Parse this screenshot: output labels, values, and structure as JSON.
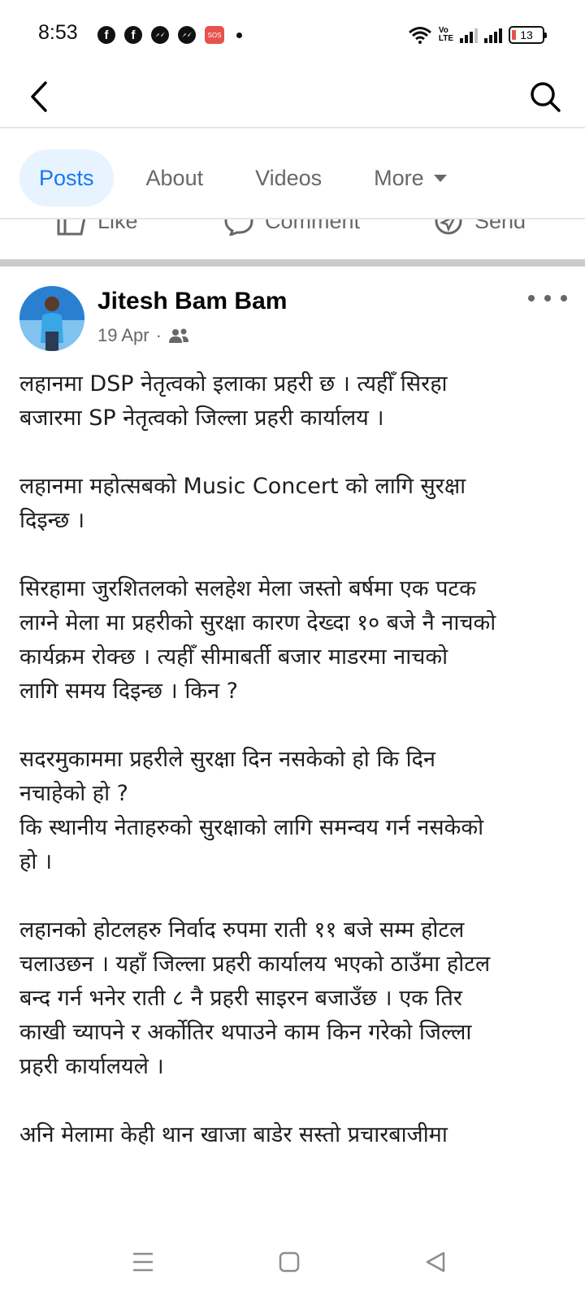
{
  "status_bar": {
    "time": "8:53",
    "battery": "13",
    "volte_label": "Vo\nLTE",
    "notification_icons": [
      "facebook-icon",
      "facebook-icon",
      "messenger-icon",
      "messenger-icon",
      "sos-icon"
    ]
  },
  "header": {
    "back_icon": "chevron-left-icon",
    "search_icon": "search-icon"
  },
  "tabs": [
    {
      "label": "Posts",
      "active": true
    },
    {
      "label": "About",
      "active": false
    },
    {
      "label": "Videos",
      "active": false
    },
    {
      "label": "More",
      "active": false
    }
  ],
  "action_bar": {
    "like": "Like",
    "comment": "Comment",
    "send": "Send"
  },
  "post": {
    "author": "Jitesh Bam Bam",
    "date": "19 Apr",
    "separator": "·",
    "audience_icon": "friends-icon",
    "paragraphs": [
      [
        "लहानमा DSP नेतृत्वको इलाका प्रहरी छ  । त्यहीँ सिरहा",
        "बजारमा SP नेतृत्वको जिल्ला प्रहरी कार्यालय ।"
      ],
      [
        "लहानमा महोत्सबको Music Concert को लागि सुरक्षा",
        "दिइन्छ ।"
      ],
      [
        "सिरहामा जुरशितलको सलहेश मेला जस्तो बर्षमा एक पटक",
        "लाग्ने मेला मा प्रहरीको सुरक्षा कारण देख्दा १० बजे नै नाचको",
        "कार्यक्रम रोक्छ । त्यहीँ सीमाबर्ती बजार माडरमा नाचको",
        "लागि समय दिइन्छ । किन ?"
      ],
      [
        "सदरमुकाममा प्रहरीले सुरक्षा दिन नसकेको हो कि दिन",
        "नचाहेको हो ?",
        "कि स्थानीय नेताहरुको सुरक्षाको लागि समन्वय गर्न नसकेको",
        "हो ।"
      ],
      [
        "लहानको होटलहरु निर्वाद रुपमा राती ११ बजे सम्म होटल",
        "चलाउछन । यहाँ जिल्ला प्रहरी कार्यालय भएको ठाउँमा होटल",
        "बन्द गर्न भनेर राती ८ नै प्रहरी साइरन बजाउँछ । एक तिर",
        "काखी च्यापने र अर्कोतिर थपाउने काम किन गरेको जिल्ला",
        "प्रहरी कार्यालयले ।"
      ],
      [
        "अनि मेलामा केही थान खाजा बाडेर सस्तो प्रचारबाजीमा"
      ]
    ]
  },
  "nav_bar": {
    "icons": [
      "menu-icon",
      "home-square-icon",
      "back-triangle-icon"
    ]
  },
  "colors": {
    "accent": "#1877f2",
    "tab_active_bg": "#e7f3ff",
    "secondary_text": "#65676b"
  }
}
